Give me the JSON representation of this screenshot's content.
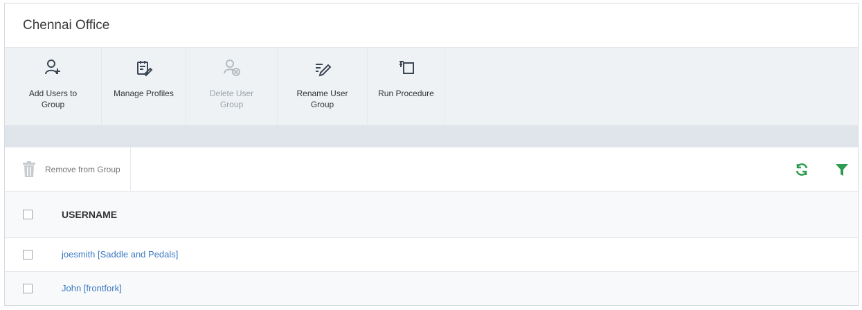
{
  "header": {
    "title": "Chennai Office"
  },
  "toolbar": {
    "add_users": {
      "label_line1": "Add Users to",
      "label_line2": "Group",
      "icon": "add-user-icon"
    },
    "manage_profiles": {
      "label_line1": "Manage Profiles",
      "label_line2": "",
      "icon": "manage-profiles-icon"
    },
    "delete_group": {
      "label_line1": "Delete User",
      "label_line2": "Group",
      "icon": "delete-group-icon",
      "disabled": true
    },
    "rename_group": {
      "label_line1": "Rename User",
      "label_line2": "Group",
      "icon": "rename-icon"
    },
    "run_procedure": {
      "label_line1": "Run Procedure",
      "label_line2": "",
      "icon": "run-procedure-icon"
    }
  },
  "actions": {
    "remove_label": "Remove from Group",
    "refresh_icon": "refresh-icon",
    "filter_icon": "filter-icon"
  },
  "table": {
    "columns": [
      "USERNAME"
    ],
    "rows": [
      {
        "username": "joesmith [Saddle and Pedals]"
      },
      {
        "username": "John [frontfork]"
      }
    ]
  },
  "colors": {
    "accent_green": "#2e9b4e",
    "link_blue": "#3b78c2",
    "toolbar_bg": "#eef2f5"
  }
}
